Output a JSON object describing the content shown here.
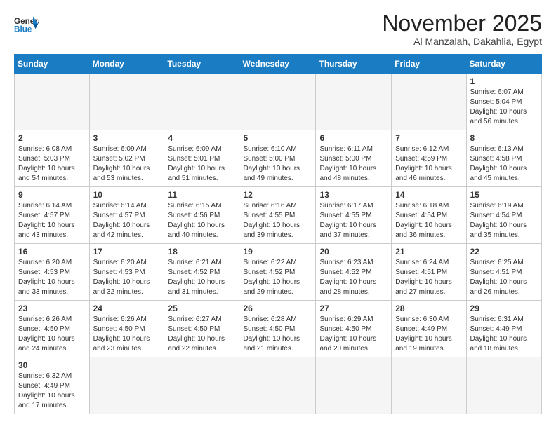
{
  "header": {
    "logo_general": "General",
    "logo_blue": "Blue",
    "title": "November 2025",
    "subtitle": "Al Manzalah, Dakahlia, Egypt"
  },
  "weekdays": [
    "Sunday",
    "Monday",
    "Tuesday",
    "Wednesday",
    "Thursday",
    "Friday",
    "Saturday"
  ],
  "weeks": [
    [
      {
        "day": "",
        "empty": true
      },
      {
        "day": "",
        "empty": true
      },
      {
        "day": "",
        "empty": true
      },
      {
        "day": "",
        "empty": true
      },
      {
        "day": "",
        "empty": true
      },
      {
        "day": "",
        "empty": true
      },
      {
        "day": "1",
        "sunrise": "6:07 AM",
        "sunset": "5:04 PM",
        "daylight": "10 hours and 56 minutes."
      }
    ],
    [
      {
        "day": "2",
        "sunrise": "6:08 AM",
        "sunset": "5:03 PM",
        "daylight": "10 hours and 54 minutes."
      },
      {
        "day": "3",
        "sunrise": "6:09 AM",
        "sunset": "5:02 PM",
        "daylight": "10 hours and 53 minutes."
      },
      {
        "day": "4",
        "sunrise": "6:09 AM",
        "sunset": "5:01 PM",
        "daylight": "10 hours and 51 minutes."
      },
      {
        "day": "5",
        "sunrise": "6:10 AM",
        "sunset": "5:00 PM",
        "daylight": "10 hours and 49 minutes."
      },
      {
        "day": "6",
        "sunrise": "6:11 AM",
        "sunset": "5:00 PM",
        "daylight": "10 hours and 48 minutes."
      },
      {
        "day": "7",
        "sunrise": "6:12 AM",
        "sunset": "4:59 PM",
        "daylight": "10 hours and 46 minutes."
      },
      {
        "day": "8",
        "sunrise": "6:13 AM",
        "sunset": "4:58 PM",
        "daylight": "10 hours and 45 minutes."
      }
    ],
    [
      {
        "day": "9",
        "sunrise": "6:14 AM",
        "sunset": "4:57 PM",
        "daylight": "10 hours and 43 minutes."
      },
      {
        "day": "10",
        "sunrise": "6:14 AM",
        "sunset": "4:57 PM",
        "daylight": "10 hours and 42 minutes."
      },
      {
        "day": "11",
        "sunrise": "6:15 AM",
        "sunset": "4:56 PM",
        "daylight": "10 hours and 40 minutes."
      },
      {
        "day": "12",
        "sunrise": "6:16 AM",
        "sunset": "4:55 PM",
        "daylight": "10 hours and 39 minutes."
      },
      {
        "day": "13",
        "sunrise": "6:17 AM",
        "sunset": "4:55 PM",
        "daylight": "10 hours and 37 minutes."
      },
      {
        "day": "14",
        "sunrise": "6:18 AM",
        "sunset": "4:54 PM",
        "daylight": "10 hours and 36 minutes."
      },
      {
        "day": "15",
        "sunrise": "6:19 AM",
        "sunset": "4:54 PM",
        "daylight": "10 hours and 35 minutes."
      }
    ],
    [
      {
        "day": "16",
        "sunrise": "6:20 AM",
        "sunset": "4:53 PM",
        "daylight": "10 hours and 33 minutes."
      },
      {
        "day": "17",
        "sunrise": "6:20 AM",
        "sunset": "4:53 PM",
        "daylight": "10 hours and 32 minutes."
      },
      {
        "day": "18",
        "sunrise": "6:21 AM",
        "sunset": "4:52 PM",
        "daylight": "10 hours and 31 minutes."
      },
      {
        "day": "19",
        "sunrise": "6:22 AM",
        "sunset": "4:52 PM",
        "daylight": "10 hours and 29 minutes."
      },
      {
        "day": "20",
        "sunrise": "6:23 AM",
        "sunset": "4:52 PM",
        "daylight": "10 hours and 28 minutes."
      },
      {
        "day": "21",
        "sunrise": "6:24 AM",
        "sunset": "4:51 PM",
        "daylight": "10 hours and 27 minutes."
      },
      {
        "day": "22",
        "sunrise": "6:25 AM",
        "sunset": "4:51 PM",
        "daylight": "10 hours and 26 minutes."
      }
    ],
    [
      {
        "day": "23",
        "sunrise": "6:26 AM",
        "sunset": "4:50 PM",
        "daylight": "10 hours and 24 minutes."
      },
      {
        "day": "24",
        "sunrise": "6:26 AM",
        "sunset": "4:50 PM",
        "daylight": "10 hours and 23 minutes."
      },
      {
        "day": "25",
        "sunrise": "6:27 AM",
        "sunset": "4:50 PM",
        "daylight": "10 hours and 22 minutes."
      },
      {
        "day": "26",
        "sunrise": "6:28 AM",
        "sunset": "4:50 PM",
        "daylight": "10 hours and 21 minutes."
      },
      {
        "day": "27",
        "sunrise": "6:29 AM",
        "sunset": "4:50 PM",
        "daylight": "10 hours and 20 minutes."
      },
      {
        "day": "28",
        "sunrise": "6:30 AM",
        "sunset": "4:49 PM",
        "daylight": "10 hours and 19 minutes."
      },
      {
        "day": "29",
        "sunrise": "6:31 AM",
        "sunset": "4:49 PM",
        "daylight": "10 hours and 18 minutes."
      }
    ],
    [
      {
        "day": "30",
        "sunrise": "6:32 AM",
        "sunset": "4:49 PM",
        "daylight": "10 hours and 17 minutes."
      },
      {
        "day": "",
        "empty": true
      },
      {
        "day": "",
        "empty": true
      },
      {
        "day": "",
        "empty": true
      },
      {
        "day": "",
        "empty": true
      },
      {
        "day": "",
        "empty": true
      },
      {
        "day": "",
        "empty": true
      }
    ]
  ]
}
